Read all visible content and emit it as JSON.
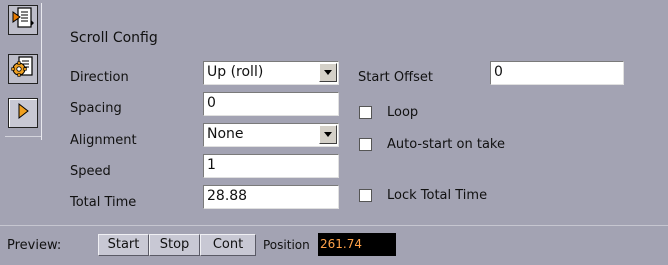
{
  "toolbar": {
    "buttons": [
      {
        "icon": "panel-export-icon"
      },
      {
        "icon": "settings-gear-icon"
      },
      {
        "icon": "play-triangle-icon"
      }
    ]
  },
  "panel": {
    "title": "Scroll Config",
    "direction": {
      "label": "Direction",
      "value": "Up (roll)"
    },
    "spacing": {
      "label": "Spacing",
      "value": "0"
    },
    "alignment": {
      "label": "Alignment",
      "value": "None"
    },
    "speed": {
      "label": "Speed",
      "value": "1"
    },
    "total_time": {
      "label": "Total Time",
      "value": "28.88"
    },
    "start_offset": {
      "label": "Start Offset",
      "value": "0"
    },
    "loop": {
      "label": "Loop",
      "checked": false
    },
    "autostart": {
      "label": "Auto-start on take",
      "checked": false
    },
    "lock_total_time": {
      "label": "Lock Total Time",
      "checked": false
    }
  },
  "preview": {
    "label": "Preview:",
    "start": "Start",
    "stop": "Stop",
    "cont": "Cont",
    "position_label": "Position",
    "position_value": "261.74"
  },
  "colors": {
    "background": "#a3a3b3",
    "position_text": "#ffa24a",
    "icon_orange": "#e87a00"
  }
}
